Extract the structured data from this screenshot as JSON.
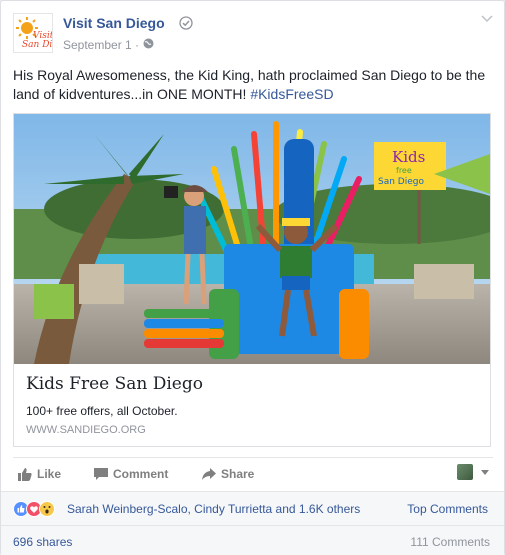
{
  "post": {
    "page_name": "Visit San Diego",
    "date": "September 1 ·",
    "text_main": "His Royal Awesomeness, the Kid King, hath proclaimed San Diego to be the land of kidventures...in ONE MONTH! ",
    "hashtag": "#KidsFreeSD",
    "logo_text": "San Diego",
    "logo_subtext": "Visit"
  },
  "link": {
    "sign_top": "Kids",
    "sign_free": "free",
    "sign_bottom": "San Diego",
    "title": "Kids Free San Diego",
    "description": "100+ free offers, all October.",
    "domain": "WWW.SANDIEGO.ORG"
  },
  "actions": {
    "like": "Like",
    "comment": "Comment",
    "share": "Share"
  },
  "reactions": {
    "names": "Sarah Weinberg-Scalo, Cindy Turrietta and 1.6K others",
    "top_comments": "Top Comments"
  },
  "footer": {
    "shares": "696 shares",
    "comments": "111 Comments"
  },
  "colors": {
    "link_blue": "#365899",
    "meta_gray": "#90949c",
    "like_blue": "#5890ff",
    "love_red": "#f25268",
    "wow_yellow": "#f7c94a"
  }
}
